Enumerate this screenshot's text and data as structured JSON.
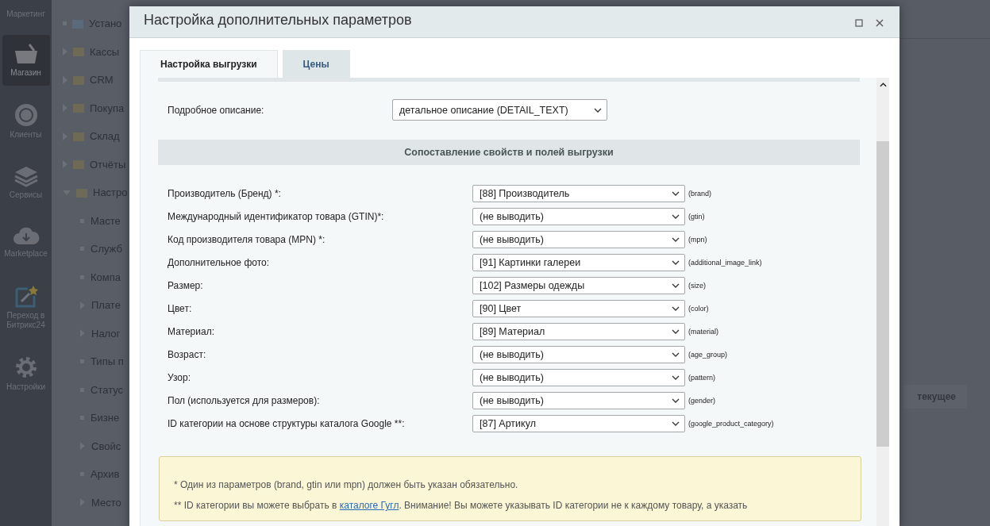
{
  "sidebar": {
    "items": [
      {
        "label": "Маркетинг",
        "selected": false
      },
      {
        "label": "Магазин",
        "selected": true
      },
      {
        "label": "Клиенты",
        "selected": false
      },
      {
        "label": "Сервисы",
        "selected": false
      },
      {
        "label": "Marketplace",
        "selected": false
      },
      {
        "label": "Переход в Битрикс24",
        "selected": false
      },
      {
        "label": "Настройки",
        "selected": false
      }
    ]
  },
  "tree": {
    "items": [
      {
        "label": "Устано",
        "kind": "leaf"
      },
      {
        "label": "Кассы",
        "kind": "branch",
        "expanded": false
      },
      {
        "label": "CRM",
        "kind": "branch",
        "expanded": false
      },
      {
        "label": "Покупа",
        "kind": "branch",
        "expanded": false
      },
      {
        "label": "Склад",
        "kind": "branch",
        "expanded": false
      },
      {
        "label": "Отчёты",
        "kind": "branch",
        "expanded": false
      },
      {
        "label": "Настро",
        "kind": "branch",
        "expanded": true,
        "children": [
          {
            "label": "Масте",
            "kind": "leaf"
          },
          {
            "label": "Служб",
            "kind": "leaf"
          },
          {
            "label": "Компа",
            "kind": "leaf"
          },
          {
            "label": "Плате",
            "kind": "branch",
            "expanded": false
          },
          {
            "label": "Налог",
            "kind": "branch",
            "expanded": false
          },
          {
            "label": "Типы п",
            "kind": "leaf"
          },
          {
            "label": "Статус",
            "kind": "leaf"
          },
          {
            "label": "Бизне",
            "kind": "leaf"
          },
          {
            "label": "Свойс",
            "kind": "branch",
            "expanded": false
          },
          {
            "label": "Архив",
            "kind": "leaf"
          },
          {
            "label": "Место",
            "kind": "branch",
            "expanded": false
          }
        ]
      }
    ]
  },
  "background_button": "текущее",
  "dialog": {
    "title": "Настройка дополнительных параметров",
    "tabs": [
      {
        "label": "Настройка выгрузки",
        "selected": true
      },
      {
        "label": "Цены",
        "selected": false
      }
    ],
    "description_field": {
      "label": "Подробное описание:",
      "value": "детальное описание (DETAIL_TEXT)"
    },
    "section_title": "Сопоставление свойств и полей выгрузки",
    "mappings": [
      {
        "label": "Производитель (Бренд) *:",
        "value": "[88] Производитель",
        "field": "(brand)"
      },
      {
        "label": "Международный идентификатор товара (GTIN)*:",
        "value": "(не выводить)",
        "field": "(gtin)"
      },
      {
        "label": "Код производителя товара (MPN) *:",
        "value": "(не выводить)",
        "field": "(mpn)"
      },
      {
        "label": "Дополнительное фото:",
        "value": "[91] Картинки галереи",
        "field": "(additional_image_link)"
      },
      {
        "label": "Размер:",
        "value": "[102] Размеры одежды",
        "field": "(size)"
      },
      {
        "label": "Цвет:",
        "value": "[90] Цвет",
        "field": "(color)"
      },
      {
        "label": "Материал:",
        "value": "[89] Материал",
        "field": "(material)"
      },
      {
        "label": "Возраст:",
        "value": "(не выводить)",
        "field": "(age_group)"
      },
      {
        "label": "Узор:",
        "value": "(не выводить)",
        "field": "(pattern)"
      },
      {
        "label": "Пол (используется для размеров):",
        "value": "(не выводить)",
        "field": "(gender)"
      },
      {
        "label": "ID категории на основе структуры каталога Google **:",
        "value": "[87] Артикул",
        "field": "(google_product_category)"
      }
    ],
    "notes": [
      {
        "parts": [
          {
            "kind": "text",
            "text": "* Один из параметров (brand, gtin или mpn) должен быть указан обязательно."
          }
        ]
      },
      {
        "parts": [
          {
            "kind": "text",
            "text": "** ID категории вы можете выбрать в "
          },
          {
            "kind": "link",
            "text": "каталоге Гугл"
          },
          {
            "kind": "text",
            "text": ". Внимание! Вы можете указывать ID категории не к каждому товару, а указать"
          }
        ]
      }
    ]
  }
}
